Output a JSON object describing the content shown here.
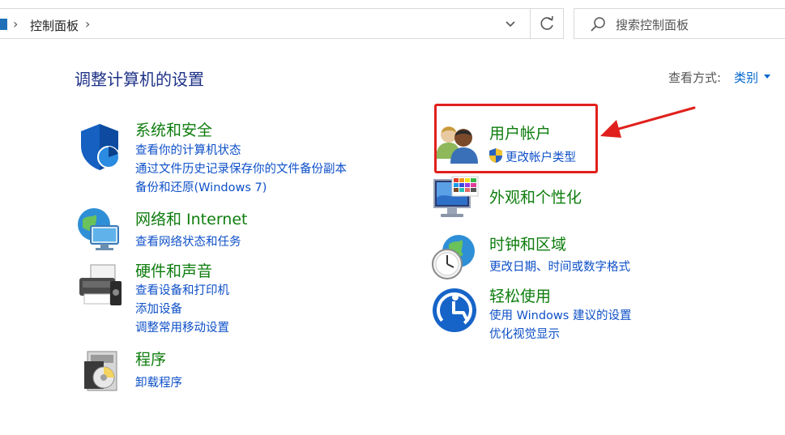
{
  "address_bar": {
    "path": "控制面板",
    "icon": "control-panel-icon"
  },
  "search": {
    "placeholder": "搜索控制面板",
    "icon": "search-icon"
  },
  "page": {
    "heading": "调整计算机的设置",
    "view_by_label": "查看方式:",
    "view_by_value": "类别"
  },
  "colors": {
    "title_green": "#0e7d0e",
    "link_blue": "#0e50c8",
    "heading_blue": "#1e3287",
    "highlight_red": "#e0201c"
  },
  "left_categories": [
    {
      "title": "系统和安全",
      "icon": "shield-icon",
      "links": [
        "查看你的计算机状态",
        "通过文件历史记录保存你的文件备份副本",
        "备份和还原(Windows 7)"
      ]
    },
    {
      "title": "网络和 Internet",
      "icon": "network-globe-icon",
      "links": [
        "查看网络状态和任务"
      ]
    },
    {
      "title": "硬件和声音",
      "icon": "printer-icon",
      "links": [
        "查看设备和打印机",
        "添加设备",
        "调整常用移动设置"
      ]
    },
    {
      "title": "程序",
      "icon": "programs-icon",
      "links": [
        "卸载程序"
      ]
    }
  ],
  "right_categories": [
    {
      "title": "用户帐户",
      "icon": "users-icon",
      "links": [
        "更改帐户类型"
      ],
      "link_icon": "uac-shield-icon"
    },
    {
      "title": "外观和个性化",
      "icon": "monitor-palette-icon",
      "links": []
    },
    {
      "title": "时钟和区域",
      "icon": "clock-globe-icon",
      "links": [
        "更改日期、时间或数字格式"
      ]
    },
    {
      "title": "轻松使用",
      "icon": "accessibility-icon",
      "links": [
        "使用 Windows 建议的设置",
        "优化视觉显示"
      ]
    }
  ]
}
